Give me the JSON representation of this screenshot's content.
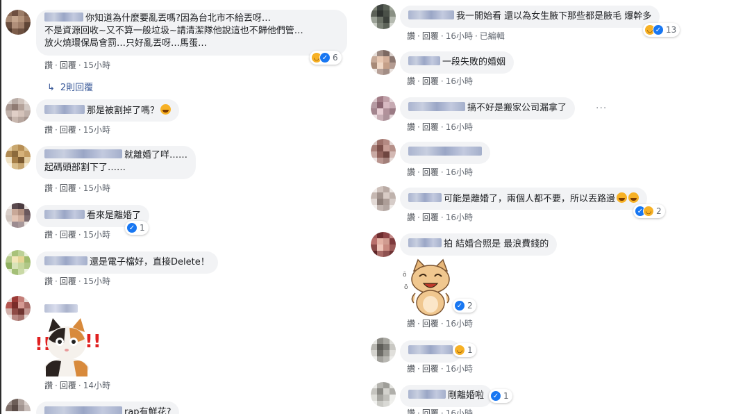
{
  "actions": {
    "like": "讚",
    "reply": "回覆",
    "dot": "·"
  },
  "left": {
    "c1": {
      "line1": "你知道為什麼要亂丟嗎?因為台北市不給丟呀…",
      "line2": "不是資源回收~又不算一般垃圾~請清潔隊他說這也不歸他們管…",
      "line3": "放火燒環保局會罰…只好亂丟呀…馬蛋…",
      "time": "15小時",
      "react_count": "6",
      "replies": "2則回覆"
    },
    "c2": {
      "text": "那是被割掉了嗎？",
      "time": "15小時"
    },
    "c3": {
      "line1": "就離婚了咩……",
      "line2": "起碼頭部割下了……",
      "time": "15小時"
    },
    "c4": {
      "text": "看來是離婚了",
      "time": "15小時",
      "react_count": "1"
    },
    "c5": {
      "text": "還是電子檔好，直接Delete！",
      "time": "15小時"
    },
    "c6": {
      "time": "14小時"
    },
    "c7": {
      "text": "rap有鮮花?"
    }
  },
  "right": {
    "r1": {
      "text": "我一開始看 還以為女生腋下那些都是腋毛 爆幹多",
      "time": "16小時",
      "edited": "已編輯",
      "react_count": "13"
    },
    "r2": {
      "text": "一段失敗的婚姻",
      "time": "16小時"
    },
    "r3": {
      "text": "搞不好是搬家公司漏拿了",
      "time": "16小時"
    },
    "r4": {
      "time": "16小時"
    },
    "r5": {
      "text": "可能是離婚了，兩個人都不要，所以丟路邊",
      "time": "16小時",
      "react_count": "2"
    },
    "r6": {
      "text": "拍 結婚合照是 最浪費錢的",
      "time": "16小時",
      "react_count": "2"
    },
    "r7": {
      "time": "16小時",
      "react_count": "1"
    },
    "r8": {
      "text": "剛離婚啦",
      "time": "16小時",
      "react_count": "1"
    }
  },
  "colors": {
    "bubble": "#f2f3f5",
    "like": "#1877f2",
    "haha": "#f7b125",
    "link": "#385898"
  }
}
